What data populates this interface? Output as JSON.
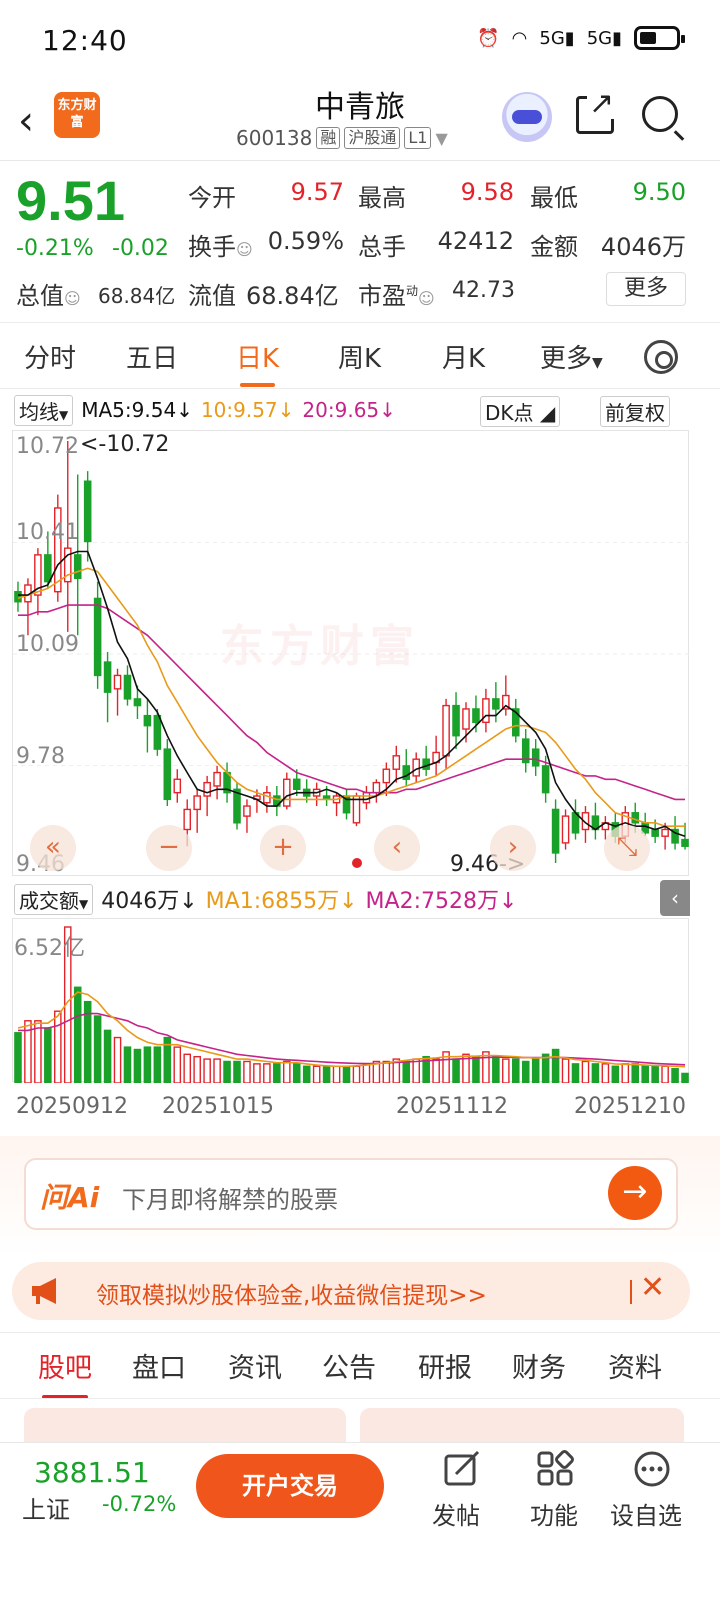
{
  "status": {
    "time": "12:40",
    "signal_a": "5G",
    "signal_b": "5G"
  },
  "header": {
    "back": "‹",
    "logo": "东方财富",
    "title": "中青旅",
    "code": "600138",
    "tags": [
      "融",
      "沪股通",
      "L1"
    ]
  },
  "quote": {
    "price": "9.51",
    "change_pct": "-0.21%",
    "change": "-0.02",
    "open_label": "今开",
    "open": "9.57",
    "high_label": "最高",
    "high": "9.58",
    "low_label": "最低",
    "low": "9.50",
    "turnover_label": "换手",
    "turnover": "0.59%",
    "volume_label": "总手",
    "volume": "42412",
    "amount_label": "金额",
    "amount": "4046万",
    "mktcap_label": "总值",
    "mktcap": "68.84亿",
    "float_label": "流值",
    "float": "68.84亿",
    "pe_label": "市盈",
    "pe_sup": "动",
    "pe": "42.73",
    "more": "更多"
  },
  "ktabs": [
    "分时",
    "五日",
    "日K",
    "周K",
    "月K",
    "更多"
  ],
  "ma": {
    "label": "均线",
    "ma5": "MA5:9.54",
    "ma10": "10:9.57",
    "ma20": "20:9.65",
    "arrow": "↓",
    "dk": "DK点",
    "fq": "前复权"
  },
  "chart_axis": {
    "y_top": "10.72",
    "y2": "10.41",
    "y3": "10.09",
    "y4": "9.78",
    "y_bottom": "9.46",
    "max_note": "<-10.72",
    "min_note": "9.46->"
  },
  "watermark": "东方财富",
  "controls": {
    "prev": "«",
    "minus": "−",
    "plus": "+",
    "left": "‹",
    "right": "›",
    "expand": "⤡"
  },
  "vol": {
    "label": "成交额",
    "value": "4046万",
    "arrow": "↓",
    "ma1": "MA1:6855万",
    "ma2": "MA2:7528万",
    "y_top": "6.52亿"
  },
  "dates": [
    "20250912",
    "20251015",
    "20251112",
    "20251210"
  ],
  "ai": {
    "logo": "问Ai",
    "placeholder": "下月即将解禁的股票",
    "go": "→"
  },
  "promo": {
    "text": "领取模拟炒股体验金,收益微信提现>>",
    "close": "✕"
  },
  "btabs": [
    "股吧",
    "盘口",
    "资讯",
    "公告",
    "研报",
    "财务",
    "资料"
  ],
  "footer": {
    "index": "3881.51",
    "index_name": "上证",
    "index_chg": "-0.72%",
    "trade": "开户交易",
    "post": "发帖",
    "func": "功能",
    "watch": "设自选"
  },
  "colors": {
    "up": "#e2242a",
    "down": "#1aa12a",
    "accent": "#f26a1b",
    "ma5": "#111111",
    "ma10": "#e89a1a",
    "ma20": "#c4248a"
  },
  "chart_data": {
    "type": "candlestick",
    "ylim": [
      9.46,
      10.72
    ],
    "candles": [
      [
        10.27,
        10.3,
        10.21,
        10.24
      ],
      [
        10.24,
        10.31,
        10.14,
        10.29
      ],
      [
        10.26,
        10.4,
        10.2,
        10.38
      ],
      [
        10.38,
        10.45,
        10.28,
        10.3
      ],
      [
        10.27,
        10.56,
        10.24,
        10.52
      ],
      [
        10.3,
        10.72,
        10.15,
        10.4
      ],
      [
        10.38,
        10.62,
        10.14,
        10.31
      ],
      [
        10.6,
        10.63,
        10.36,
        10.42
      ],
      [
        10.25,
        10.3,
        9.98,
        10.02
      ],
      [
        10.06,
        10.09,
        9.88,
        9.97
      ],
      [
        9.98,
        10.04,
        9.9,
        10.02
      ],
      [
        10.02,
        10.05,
        9.93,
        9.95
      ],
      [
        9.95,
        9.99,
        9.89,
        9.93
      ],
      [
        9.9,
        9.95,
        9.79,
        9.87
      ],
      [
        9.9,
        9.92,
        9.78,
        9.8
      ],
      [
        9.8,
        9.83,
        9.63,
        9.65
      ],
      [
        9.67,
        9.74,
        9.64,
        9.71
      ],
      [
        9.56,
        9.65,
        9.51,
        9.62
      ],
      [
        9.62,
        9.68,
        9.55,
        9.66
      ],
      [
        9.66,
        9.72,
        9.6,
        9.7
      ],
      [
        9.69,
        9.75,
        9.65,
        9.73
      ],
      [
        9.73,
        9.76,
        9.64,
        9.67
      ],
      [
        9.68,
        9.7,
        9.56,
        9.58
      ],
      [
        9.6,
        9.65,
        9.55,
        9.63
      ],
      [
        9.65,
        9.68,
        9.61,
        9.66
      ],
      [
        9.64,
        9.69,
        9.61,
        9.67
      ],
      [
        9.66,
        9.69,
        9.6,
        9.63
      ],
      [
        9.63,
        9.73,
        9.62,
        9.71
      ],
      [
        9.71,
        9.74,
        9.66,
        9.68
      ],
      [
        9.68,
        9.71,
        9.64,
        9.66
      ],
      [
        9.66,
        9.7,
        9.63,
        9.68
      ],
      [
        9.66,
        9.69,
        9.63,
        9.65
      ],
      [
        9.64,
        9.67,
        9.6,
        9.66
      ],
      [
        9.66,
        9.68,
        9.59,
        9.61
      ],
      [
        9.58,
        9.67,
        9.57,
        9.66
      ],
      [
        9.64,
        9.69,
        9.62,
        9.67
      ],
      [
        9.67,
        9.71,
        9.64,
        9.7
      ],
      [
        9.7,
        9.76,
        9.66,
        9.74
      ],
      [
        9.74,
        9.81,
        9.7,
        9.78
      ],
      [
        9.75,
        9.8,
        9.69,
        9.71
      ],
      [
        9.72,
        9.79,
        9.7,
        9.77
      ],
      [
        9.77,
        9.81,
        9.72,
        9.74
      ],
      [
        9.76,
        9.84,
        9.72,
        9.79
      ],
      [
        9.78,
        9.95,
        9.74,
        9.93
      ],
      [
        9.93,
        9.97,
        9.8,
        9.84
      ],
      [
        9.86,
        9.94,
        9.82,
        9.92
      ],
      [
        9.92,
        9.96,
        9.85,
        9.88
      ],
      [
        9.88,
        9.98,
        9.85,
        9.95
      ],
      [
        9.95,
        10.0,
        9.88,
        9.92
      ],
      [
        9.92,
        10.02,
        9.9,
        9.96
      ],
      [
        9.92,
        9.95,
        9.82,
        9.84
      ],
      [
        9.83,
        9.86,
        9.73,
        9.76
      ],
      [
        9.8,
        9.83,
        9.72,
        9.75
      ],
      [
        9.75,
        9.78,
        9.64,
        9.67
      ],
      [
        9.62,
        9.65,
        9.46,
        9.49
      ],
      [
        9.52,
        9.62,
        9.5,
        9.6
      ],
      [
        9.61,
        9.65,
        9.53,
        9.55
      ],
      [
        9.56,
        9.63,
        9.52,
        9.61
      ],
      [
        9.6,
        9.64,
        9.53,
        9.56
      ],
      [
        9.56,
        9.6,
        9.53,
        9.58
      ],
      [
        9.58,
        9.61,
        9.52,
        9.54
      ],
      [
        9.54,
        9.63,
        9.52,
        9.61
      ],
      [
        9.61,
        9.64,
        9.55,
        9.58
      ],
      [
        9.58,
        9.61,
        9.54,
        9.55
      ],
      [
        9.56,
        9.59,
        9.52,
        9.54
      ],
      [
        9.54,
        9.58,
        9.5,
        9.56
      ],
      [
        9.56,
        9.6,
        9.5,
        9.52
      ],
      [
        9.53,
        9.58,
        9.5,
        9.51
      ]
    ],
    "ma5": [
      10.26,
      10.26,
      10.28,
      10.29,
      10.35,
      10.38,
      10.39,
      10.39,
      10.31,
      10.22,
      10.12,
      10.07,
      9.98,
      9.95,
      9.91,
      9.84,
      9.78,
      9.73,
      9.68,
      9.67,
      9.68,
      9.68,
      9.67,
      9.66,
      9.65,
      9.63,
      9.63,
      9.66,
      9.67,
      9.67,
      9.67,
      9.68,
      9.67,
      9.65,
      9.65,
      9.65,
      9.66,
      9.68,
      9.71,
      9.72,
      9.74,
      9.75,
      9.76,
      9.78,
      9.81,
      9.84,
      9.87,
      9.9,
      9.9,
      9.93,
      9.91,
      9.88,
      9.85,
      9.8,
      9.7,
      9.65,
      9.61,
      9.58,
      9.56,
      9.58,
      9.57,
      9.58,
      9.57,
      9.57,
      9.56,
      9.57,
      9.55,
      9.54
    ],
    "ma10": [
      10.25,
      10.26,
      10.27,
      10.28,
      10.3,
      10.32,
      10.33,
      10.34,
      10.33,
      10.29,
      10.25,
      10.21,
      10.17,
      10.11,
      10.06,
      9.99,
      9.94,
      9.89,
      9.84,
      9.8,
      9.76,
      9.73,
      9.7,
      9.68,
      9.67,
      9.66,
      9.65,
      9.65,
      9.65,
      9.65,
      9.65,
      9.65,
      9.65,
      9.66,
      9.66,
      9.66,
      9.66,
      9.67,
      9.68,
      9.69,
      9.7,
      9.71,
      9.72,
      9.74,
      9.76,
      9.78,
      9.8,
      9.82,
      9.84,
      9.86,
      9.87,
      9.87,
      9.86,
      9.85,
      9.82,
      9.78,
      9.74,
      9.71,
      9.67,
      9.64,
      9.61,
      9.6,
      9.59,
      9.58,
      9.58,
      9.57,
      9.57,
      9.57
    ],
    "ma20": [
      10.2,
      10.2,
      10.21,
      10.21,
      10.22,
      10.23,
      10.23,
      10.23,
      10.23,
      10.22,
      10.2,
      10.18,
      10.16,
      10.14,
      10.11,
      10.08,
      10.05,
      10.02,
      9.99,
      9.96,
      9.93,
      9.9,
      9.87,
      9.84,
      9.82,
      9.79,
      9.77,
      9.75,
      9.73,
      9.72,
      9.71,
      9.7,
      9.69,
      9.68,
      9.68,
      9.67,
      9.67,
      9.67,
      9.67,
      9.68,
      9.68,
      9.69,
      9.7,
      9.71,
      9.72,
      9.73,
      9.74,
      9.75,
      9.76,
      9.77,
      9.77,
      9.77,
      9.77,
      9.76,
      9.75,
      9.74,
      9.73,
      9.72,
      9.72,
      9.71,
      9.71,
      9.7,
      9.69,
      9.68,
      9.67,
      9.66,
      9.65,
      9.65
    ],
    "volume_ylim_label": "6.52亿",
    "volume": [
      2.1,
      2.6,
      2.6,
      2.3,
      3.0,
      6.52,
      4.0,
      3.4,
      2.8,
      2.2,
      1.9,
      1.5,
      1.4,
      1.5,
      1.5,
      1.9,
      1.5,
      1.2,
      1.1,
      1.0,
      1.0,
      0.9,
      0.9,
      0.9,
      0.8,
      0.8,
      0.8,
      0.9,
      0.8,
      0.7,
      0.7,
      0.7,
      0.7,
      0.7,
      0.7,
      0.8,
      0.9,
      0.9,
      1.0,
      0.9,
      1.0,
      1.1,
      1.0,
      1.3,
      1.0,
      1.2,
      1.1,
      1.3,
      1.1,
      1.0,
      1.0,
      0.9,
      1.0,
      1.2,
      1.4,
      1.0,
      0.8,
      0.9,
      0.8,
      0.8,
      0.7,
      0.8,
      0.8,
      0.7,
      0.7,
      0.7,
      0.6,
      0.4
    ],
    "vol_ma1": [
      2.3,
      2.4,
      2.5,
      2.5,
      2.8,
      3.4,
      3.8,
      3.7,
      3.4,
      2.9,
      2.6,
      2.2,
      1.9,
      1.7,
      1.6,
      1.6,
      1.6,
      1.5,
      1.4,
      1.3,
      1.2,
      1.1,
      1.0,
      1.0,
      0.95,
      0.9,
      0.85,
      0.85,
      0.85,
      0.8,
      0.75,
      0.72,
      0.7,
      0.7,
      0.72,
      0.75,
      0.8,
      0.85,
      0.9,
      0.95,
      1.0,
      1.02,
      1.05,
      1.1,
      1.1,
      1.12,
      1.12,
      1.15,
      1.15,
      1.12,
      1.1,
      1.06,
      1.04,
      1.06,
      1.1,
      1.05,
      0.98,
      0.95,
      0.9,
      0.85,
      0.8,
      0.78,
      0.77,
      0.75,
      0.73,
      0.72,
      0.7,
      0.68
    ],
    "vol_ma2": [
      2.2,
      2.2,
      2.3,
      2.3,
      2.4,
      2.6,
      2.8,
      2.9,
      2.9,
      2.8,
      2.7,
      2.6,
      2.4,
      2.3,
      2.1,
      2.0,
      1.8,
      1.7,
      1.6,
      1.5,
      1.4,
      1.3,
      1.2,
      1.15,
      1.1,
      1.05,
      1.0,
      0.97,
      0.95,
      0.92,
      0.9,
      0.87,
      0.85,
      0.83,
      0.82,
      0.81,
      0.82,
      0.84,
      0.86,
      0.88,
      0.9,
      0.93,
      0.95,
      0.98,
      1.0,
      1.02,
      1.04,
      1.06,
      1.08,
      1.08,
      1.07,
      1.06,
      1.06,
      1.06,
      1.07,
      1.06,
      1.04,
      1.02,
      1.0,
      0.97,
      0.94,
      0.91,
      0.88,
      0.85,
      0.82,
      0.8,
      0.78,
      0.76
    ]
  }
}
